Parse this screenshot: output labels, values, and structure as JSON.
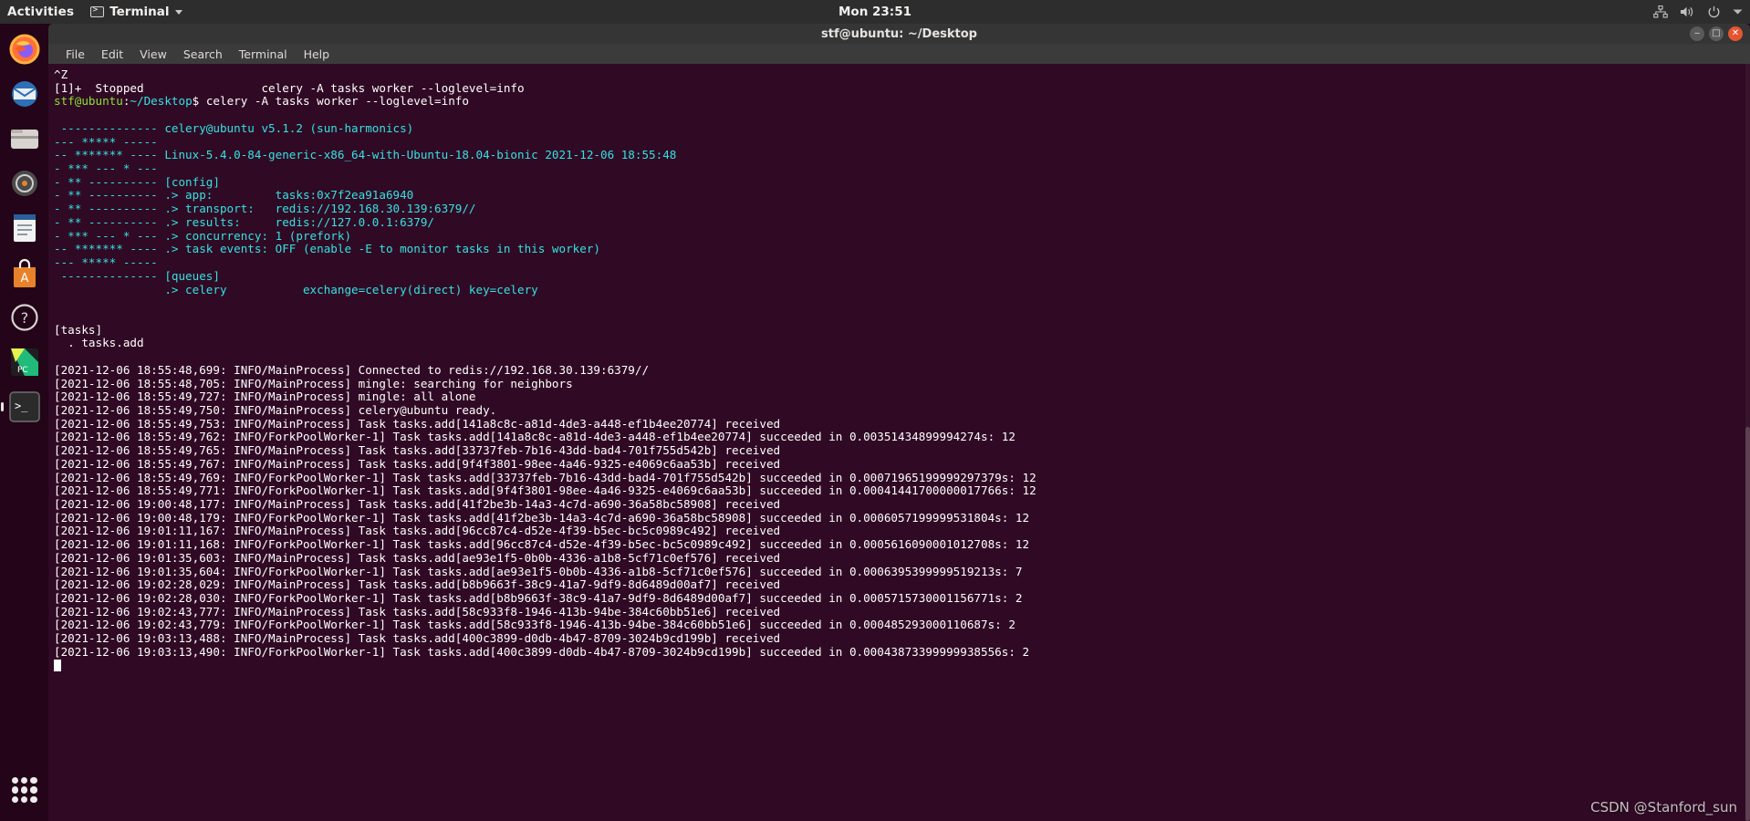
{
  "topbar": {
    "activities": "Activities",
    "app_name": "Terminal",
    "app_icon": "terminal-icon",
    "clock": "Mon 23:51",
    "tray": [
      {
        "name": "network-icon",
        "glyph": "network"
      },
      {
        "name": "volume-icon",
        "glyph": "volume"
      },
      {
        "name": "power-icon",
        "glyph": "power"
      },
      {
        "name": "chevron-down-icon",
        "glyph": "chevron"
      }
    ]
  },
  "dock": {
    "items": [
      {
        "name": "firefox",
        "label": "Firefox"
      },
      {
        "name": "thunderbird",
        "label": "Thunderbird"
      },
      {
        "name": "files",
        "label": "Files"
      },
      {
        "name": "rhythmbox",
        "label": "Rhythmbox"
      },
      {
        "name": "libreoffice-writer",
        "label": "LibreOffice Writer"
      },
      {
        "name": "ubuntu-software",
        "label": "Ubuntu Software"
      },
      {
        "name": "help",
        "label": "Help"
      },
      {
        "name": "pycharm",
        "label": "PyCharm"
      },
      {
        "name": "terminal",
        "label": "Terminal"
      }
    ],
    "show_apps_label": "Show Applications"
  },
  "window": {
    "title": "stf@ubuntu: ~/Desktop",
    "buttons": {
      "minimize": "‒",
      "maximize": "□",
      "close": "✕"
    },
    "menu": [
      "File",
      "Edit",
      "View",
      "Search",
      "Terminal",
      "Help"
    ]
  },
  "terminal": {
    "lines": [
      {
        "t": "^Z",
        "c": "white"
      },
      {
        "t": "[1]+  Stopped                 celery -A tasks worker --loglevel=info",
        "c": "white"
      },
      {
        "segs": [
          {
            "t": "stf@ubuntu",
            "c": "green"
          },
          {
            "t": ":",
            "c": "white"
          },
          {
            "t": "~/Desktop",
            "c": "cyan"
          },
          {
            "t": "$ celery -A tasks worker --loglevel=info",
            "c": "white"
          }
        ]
      },
      {
        "t": "",
        "c": "white"
      },
      {
        "t": " -------------- celery@ubuntu v5.1.2 (sun-harmonics)",
        "c": "cyan"
      },
      {
        "t": "--- ***** ----- ",
        "c": "cyan"
      },
      {
        "t": "-- ******* ---- Linux-5.4.0-84-generic-x86_64-with-Ubuntu-18.04-bionic 2021-12-06 18:55:48",
        "c": "cyan"
      },
      {
        "t": "- *** --- * --- ",
        "c": "cyan"
      },
      {
        "t": "- ** ---------- [config]",
        "c": "cyan"
      },
      {
        "t": "- ** ---------- .> app:         tasks:0x7f2ea91a6940",
        "c": "cyan"
      },
      {
        "t": "- ** ---------- .> transport:   redis://192.168.30.139:6379//",
        "c": "cyan"
      },
      {
        "t": "- ** ---------- .> results:     redis://127.0.0.1:6379/",
        "c": "cyan"
      },
      {
        "t": "- *** --- * --- .> concurrency: 1 (prefork)",
        "c": "cyan"
      },
      {
        "t": "-- ******* ---- .> task events: OFF (enable -E to monitor tasks in this worker)",
        "c": "cyan"
      },
      {
        "t": "--- ***** ----- ",
        "c": "cyan"
      },
      {
        "t": " -------------- [queues]",
        "c": "cyan"
      },
      {
        "t": "                .> celery           exchange=celery(direct) key=celery",
        "c": "cyan"
      },
      {
        "t": "",
        "c": "white"
      },
      {
        "t": "",
        "c": "white"
      },
      {
        "t": "[tasks]",
        "c": "white"
      },
      {
        "t": "  . tasks.add",
        "c": "white"
      },
      {
        "t": "",
        "c": "white"
      },
      {
        "t": "[2021-12-06 18:55:48,699: INFO/MainProcess] Connected to redis://192.168.30.139:6379//",
        "c": "white"
      },
      {
        "t": "[2021-12-06 18:55:48,705: INFO/MainProcess] mingle: searching for neighbors",
        "c": "white"
      },
      {
        "t": "[2021-12-06 18:55:49,727: INFO/MainProcess] mingle: all alone",
        "c": "white"
      },
      {
        "t": "[2021-12-06 18:55:49,750: INFO/MainProcess] celery@ubuntu ready.",
        "c": "white"
      },
      {
        "t": "[2021-12-06 18:55:49,753: INFO/MainProcess] Task tasks.add[141a8c8c-a81d-4de3-a448-ef1b4ee20774] received",
        "c": "white"
      },
      {
        "t": "[2021-12-06 18:55:49,762: INFO/ForkPoolWorker-1] Task tasks.add[141a8c8c-a81d-4de3-a448-ef1b4ee20774] succeeded in 0.00351434899994274s: 12",
        "c": "white"
      },
      {
        "t": "[2021-12-06 18:55:49,765: INFO/MainProcess] Task tasks.add[33737feb-7b16-43dd-bad4-701f755d542b] received",
        "c": "white"
      },
      {
        "t": "[2021-12-06 18:55:49,767: INFO/MainProcess] Task tasks.add[9f4f3801-98ee-4a46-9325-e4069c6aa53b] received",
        "c": "white"
      },
      {
        "t": "[2021-12-06 18:55:49,769: INFO/ForkPoolWorker-1] Task tasks.add[33737feb-7b16-43dd-bad4-701f755d542b] succeeded in 0.00071965199999297379s: 12",
        "c": "white"
      },
      {
        "t": "[2021-12-06 18:55:49,771: INFO/ForkPoolWorker-1] Task tasks.add[9f4f3801-98ee-4a46-9325-e4069c6aa53b] succeeded in 0.00041441700000017766s: 12",
        "c": "white"
      },
      {
        "t": "[2021-12-06 19:00:48,177: INFO/MainProcess] Task tasks.add[41f2be3b-14a3-4c7d-a690-36a58bc58908] received",
        "c": "white"
      },
      {
        "t": "[2021-12-06 19:00:48,179: INFO/ForkPoolWorker-1] Task tasks.add[41f2be3b-14a3-4c7d-a690-36a58bc58908] succeeded in 0.0006057199999531804s: 12",
        "c": "white"
      },
      {
        "t": "[2021-12-06 19:01:11,167: INFO/MainProcess] Task tasks.add[96cc87c4-d52e-4f39-b5ec-bc5c0989c492] received",
        "c": "white"
      },
      {
        "t": "[2021-12-06 19:01:11,168: INFO/ForkPoolWorker-1] Task tasks.add[96cc87c4-d52e-4f39-b5ec-bc5c0989c492] succeeded in 0.0005616090001012708s: 12",
        "c": "white"
      },
      {
        "t": "[2021-12-06 19:01:35,603: INFO/MainProcess] Task tasks.add[ae93e1f5-0b0b-4336-a1b8-5cf71c0ef576] received",
        "c": "white"
      },
      {
        "t": "[2021-12-06 19:01:35,604: INFO/ForkPoolWorker-1] Task tasks.add[ae93e1f5-0b0b-4336-a1b8-5cf71c0ef576] succeeded in 0.0006395399999519213s: 7",
        "c": "white"
      },
      {
        "t": "[2021-12-06 19:02:28,029: INFO/MainProcess] Task tasks.add[b8b9663f-38c9-41a7-9df9-8d6489d00af7] received",
        "c": "white"
      },
      {
        "t": "[2021-12-06 19:02:28,030: INFO/ForkPoolWorker-1] Task tasks.add[b8b9663f-38c9-41a7-9df9-8d6489d00af7] succeeded in 0.0005715730001156771s: 2",
        "c": "white"
      },
      {
        "t": "[2021-12-06 19:02:43,777: INFO/MainProcess] Task tasks.add[58c933f8-1946-413b-94be-384c60bb51e6] received",
        "c": "white"
      },
      {
        "t": "[2021-12-06 19:02:43,779: INFO/ForkPoolWorker-1] Task tasks.add[58c933f8-1946-413b-94be-384c60bb51e6] succeeded in 0.000485293000110687s: 2",
        "c": "white"
      },
      {
        "t": "[2021-12-06 19:03:13,488: INFO/MainProcess] Task tasks.add[400c3899-d0db-4b47-8709-3024b9cd199b] received",
        "c": "white"
      },
      {
        "t": "[2021-12-06 19:03:13,490: INFO/ForkPoolWorker-1] Task tasks.add[400c3899-d0db-4b47-8709-3024b9cd199b] succeeded in 0.00043873399999938556s: 2",
        "c": "white"
      }
    ]
  },
  "watermark": "CSDN @Stanford_sun",
  "colors": {
    "terminal_bg": "#300a24",
    "accent_cyan": "#34e2e2",
    "prompt_green": "#8ae234",
    "close_button": "#e6552f",
    "topbar_bg": "#2d2d2d"
  }
}
